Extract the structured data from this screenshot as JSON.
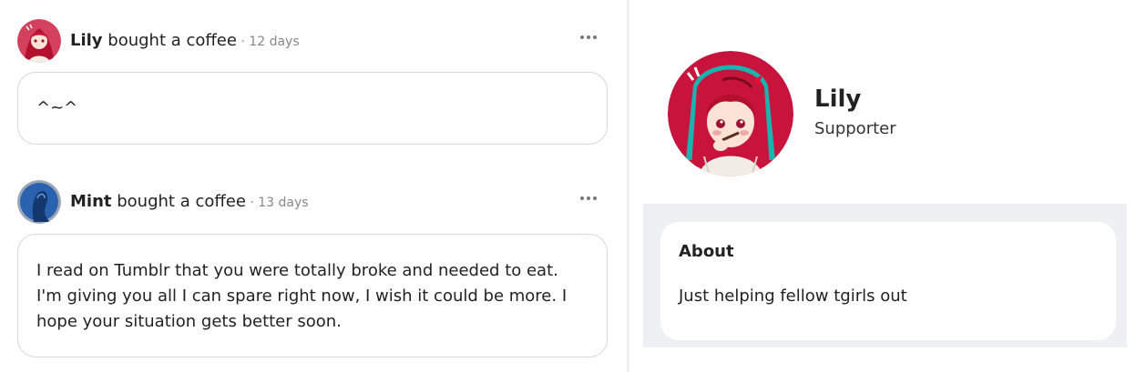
{
  "feed": {
    "posts": [
      {
        "name": "Lily",
        "action": " bought a coffee",
        "time": " · 12 days",
        "avatar_icon": "red-haired-girl-avatar",
        "message": "^~^"
      },
      {
        "name": "Mint",
        "action": " bought a coffee",
        "time": " · 13 days",
        "avatar_icon": "blue-silhouette-avatar",
        "message_lines": [
          "I read on Tumblr that you were totally broke and needed to eat.",
          "I'm giving you all I can spare right now, I wish it could be more. I",
          "hope your situation gets better soon."
        ]
      }
    ],
    "more_icon": "more-options-icon"
  },
  "profile": {
    "name": "Lily",
    "role": "Supporter",
    "avatar_icon": "red-haired-girl-avatar"
  },
  "about": {
    "title": "About",
    "text": "Just helping fellow tgirls out"
  },
  "colors": {
    "page_bg": "#ffffff",
    "panel_bg": "#eef0f4",
    "border": "#d6d8dd",
    "muted_text": "#888888",
    "avatar_red": "#c8143c",
    "avatar_blue": "#1e5aa8"
  }
}
